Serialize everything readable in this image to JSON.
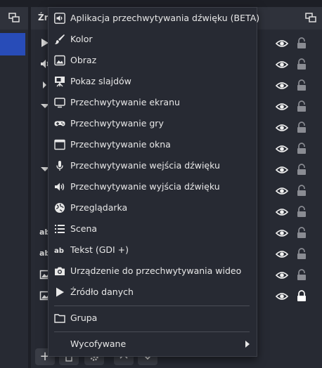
{
  "sources_panel": {
    "title": "Źr"
  },
  "context_menu": {
    "items": [
      {
        "label": "Aplikacja przechwytywania dźwięku (BETA)",
        "icon": "speaker-box-icon"
      },
      {
        "label": "Kolor",
        "icon": "paint-brush-icon"
      },
      {
        "label": "Obraz",
        "icon": "image-icon"
      },
      {
        "label": "Pokaz slajdów",
        "icon": "slideshow-icon"
      },
      {
        "label": "Przechwytywanie ekranu",
        "icon": "monitor-icon"
      },
      {
        "label": "Przechwytywanie gry",
        "icon": "gamepad-icon"
      },
      {
        "label": "Przechwytywanie okna",
        "icon": "window-icon"
      },
      {
        "label": "Przechwytywanie wejścia dźwięku",
        "icon": "microphone-icon"
      },
      {
        "label": "Przechwytywanie wyjścia dźwięku",
        "icon": "speaker-icon"
      },
      {
        "label": "Przeglądarka",
        "icon": "globe-icon"
      },
      {
        "label": "Scena",
        "icon": "list-icon"
      },
      {
        "label": "Tekst (GDI +)",
        "icon": "text-icon"
      },
      {
        "label": "Urządzenie do przechwytywania wideo",
        "icon": "camera-icon"
      },
      {
        "label": "Źródło danych",
        "icon": "play-icon"
      }
    ],
    "group_label": "Grupa",
    "deprecated_label": "Wycofywane"
  },
  "source_row_icons": [
    {
      "icon": "play-icon"
    },
    {
      "icon": "speaker-icon"
    },
    {
      "icon": "chevron-right-icon"
    },
    {
      "icon": "chevron-down-icon"
    },
    {
      "icon": "chevron-down-icon"
    },
    {
      "icon": "text-icon",
      "text": "ab"
    },
    {
      "icon": "text-icon",
      "text": "ab"
    },
    {
      "icon": "image-icon"
    },
    {
      "icon": "image-icon"
    }
  ],
  "toolbar": {
    "add_symbol": "+"
  },
  "colors": {
    "background": "#1d1f26",
    "panel": "#272a33",
    "header": "#2f323b",
    "selected_scene": "#284cb8",
    "text": "#e8e8e8"
  }
}
